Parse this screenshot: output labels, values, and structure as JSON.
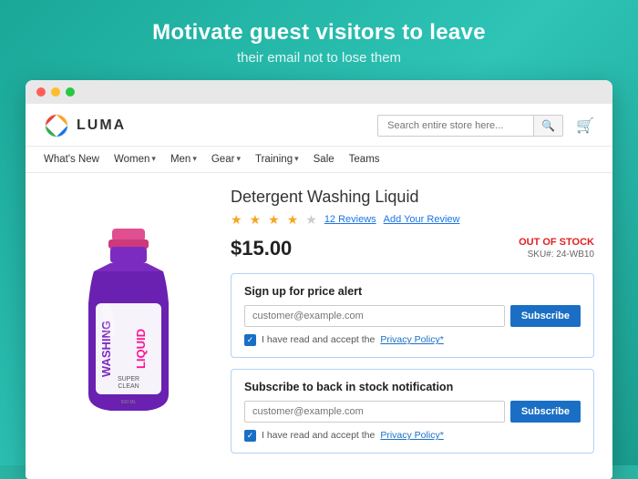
{
  "hero": {
    "title": "Motivate guest visitors to leave",
    "subtitle": "their email not to lose them"
  },
  "browser": {
    "dots": [
      "red",
      "yellow",
      "green"
    ]
  },
  "store": {
    "logo_text": "LUMA",
    "search_placeholder": "Search entire store here...",
    "nav_items": [
      {
        "label": "What's New",
        "has_chevron": false
      },
      {
        "label": "Women",
        "has_chevron": true
      },
      {
        "label": "Men",
        "has_chevron": true
      },
      {
        "label": "Gear",
        "has_chevron": true
      },
      {
        "label": "Training",
        "has_chevron": true
      },
      {
        "label": "Sale",
        "has_chevron": false
      },
      {
        "label": "Teams",
        "has_chevron": false
      }
    ]
  },
  "product": {
    "name": "Detergent Washing Liquid",
    "stars_filled": 4,
    "stars_total": 5,
    "review_count": "12 Reviews",
    "add_review": "Add Your Review",
    "price": "$15.00",
    "stock_status": "OUT OF STOCK",
    "sku_label": "SKU#: 24-WB10"
  },
  "price_alert": {
    "title": "Sign up for price alert",
    "email_placeholder": "customer@example.com",
    "subscribe_label": "Subscribe",
    "policy_text": "I have read and accept the ",
    "policy_link": "Privacy Policy*"
  },
  "stock_notification": {
    "title": "Subscribe to back in stock notification",
    "email_placeholder": "customer@example.com",
    "subscribe_label": "Subscribe",
    "policy_text": "I have read and accept the ",
    "policy_link": "Privacy Policy*"
  }
}
